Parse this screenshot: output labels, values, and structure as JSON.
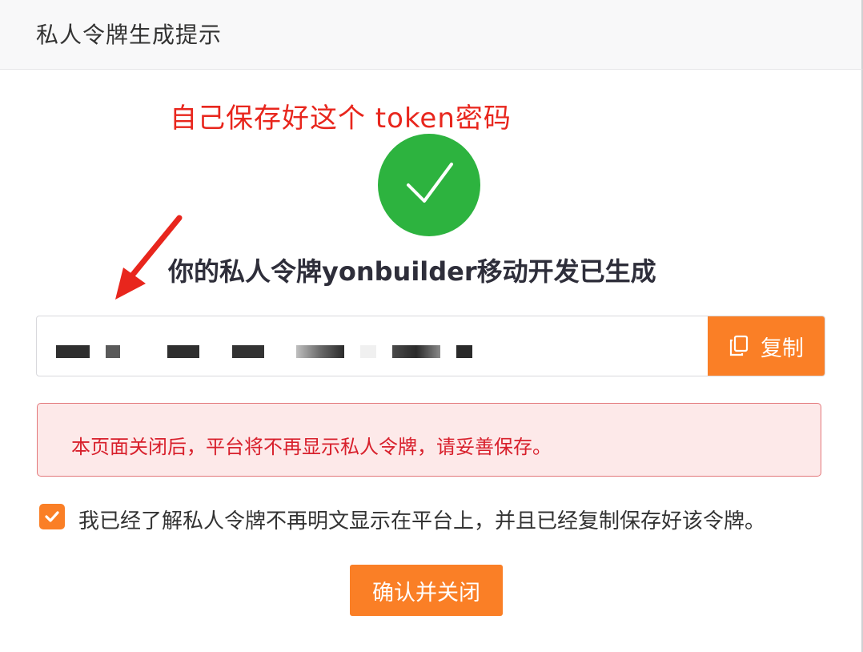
{
  "dialog": {
    "title": "私人令牌生成提示"
  },
  "annotation": {
    "text": "自己保存好这个 token密码",
    "color": "#e8261d"
  },
  "result": {
    "headline": "你的私人令牌yonbuilder移动开发已生成",
    "icon": "checkmark-icon",
    "success_color": "#2db33f"
  },
  "token": {
    "copy_label": "复制",
    "copy_icon": "copy-icon"
  },
  "warning": {
    "text": "本页面关闭后，平台将不再显示私人令牌，请妥善保存。"
  },
  "acknowledge": {
    "label": "我已经了解私人令牌不再明文显示在平台上，并且已经复制保存好该令牌。",
    "checked": true
  },
  "actions": {
    "confirm_label": "确认并关闭"
  },
  "colors": {
    "accent": "#fa7f26",
    "warning_text": "#d8202c",
    "warning_bg": "#fde9e9"
  }
}
